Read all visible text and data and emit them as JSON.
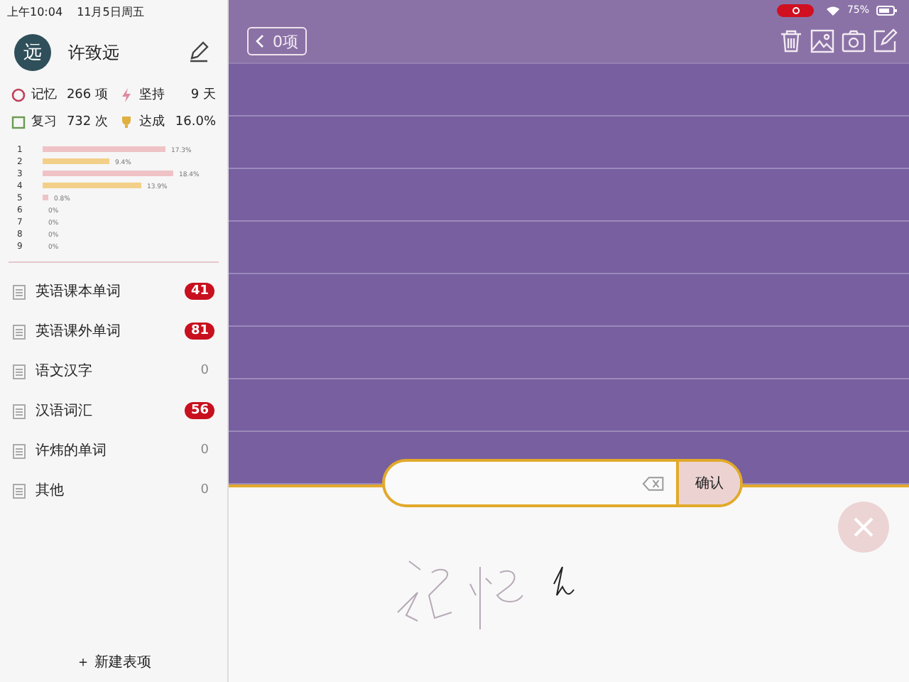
{
  "status_bar": {
    "time": "上午10:04",
    "date": "11月5日周五",
    "battery": "75%",
    "recording": true
  },
  "profile": {
    "avatar": "远",
    "name": "许致远"
  },
  "stats": [
    {
      "kind": "memory",
      "label": "记忆",
      "value": "266 项"
    },
    {
      "kind": "streak",
      "label": "坚持",
      "value": "9 天"
    },
    {
      "kind": "review",
      "label": "复习",
      "value": "732 次"
    },
    {
      "kind": "goal",
      "label": "达成",
      "value": "16.0%"
    }
  ],
  "chart_data": {
    "type": "bar",
    "orientation": "horizontal",
    "categories": [
      "1",
      "2",
      "3",
      "4",
      "5",
      "6",
      "7",
      "8",
      "9"
    ],
    "values": [
      17.3,
      9.4,
      18.4,
      13.9,
      0.8,
      0,
      0,
      0,
      0
    ],
    "value_labels": [
      "17.3%",
      "9.4%",
      "18.4%",
      "13.9%",
      "0.8%",
      "0%",
      "0%",
      "0%",
      "0%"
    ]
  },
  "lists": [
    {
      "name": "英语课本单词",
      "count": "41",
      "due": true
    },
    {
      "name": "英语课外单词",
      "count": "81",
      "due": true
    },
    {
      "name": "语文汉字",
      "count": "0",
      "due": false
    },
    {
      "name": "汉语词汇",
      "count": "56",
      "due": true
    },
    {
      "name": "许炜的单词",
      "count": "0",
      "due": false
    },
    {
      "name": "其他",
      "count": "0",
      "due": false
    }
  ],
  "new_list_button": "＋ 新建表项",
  "toolbar": {
    "back_label": "0项"
  },
  "input": {
    "confirm": "确认"
  }
}
